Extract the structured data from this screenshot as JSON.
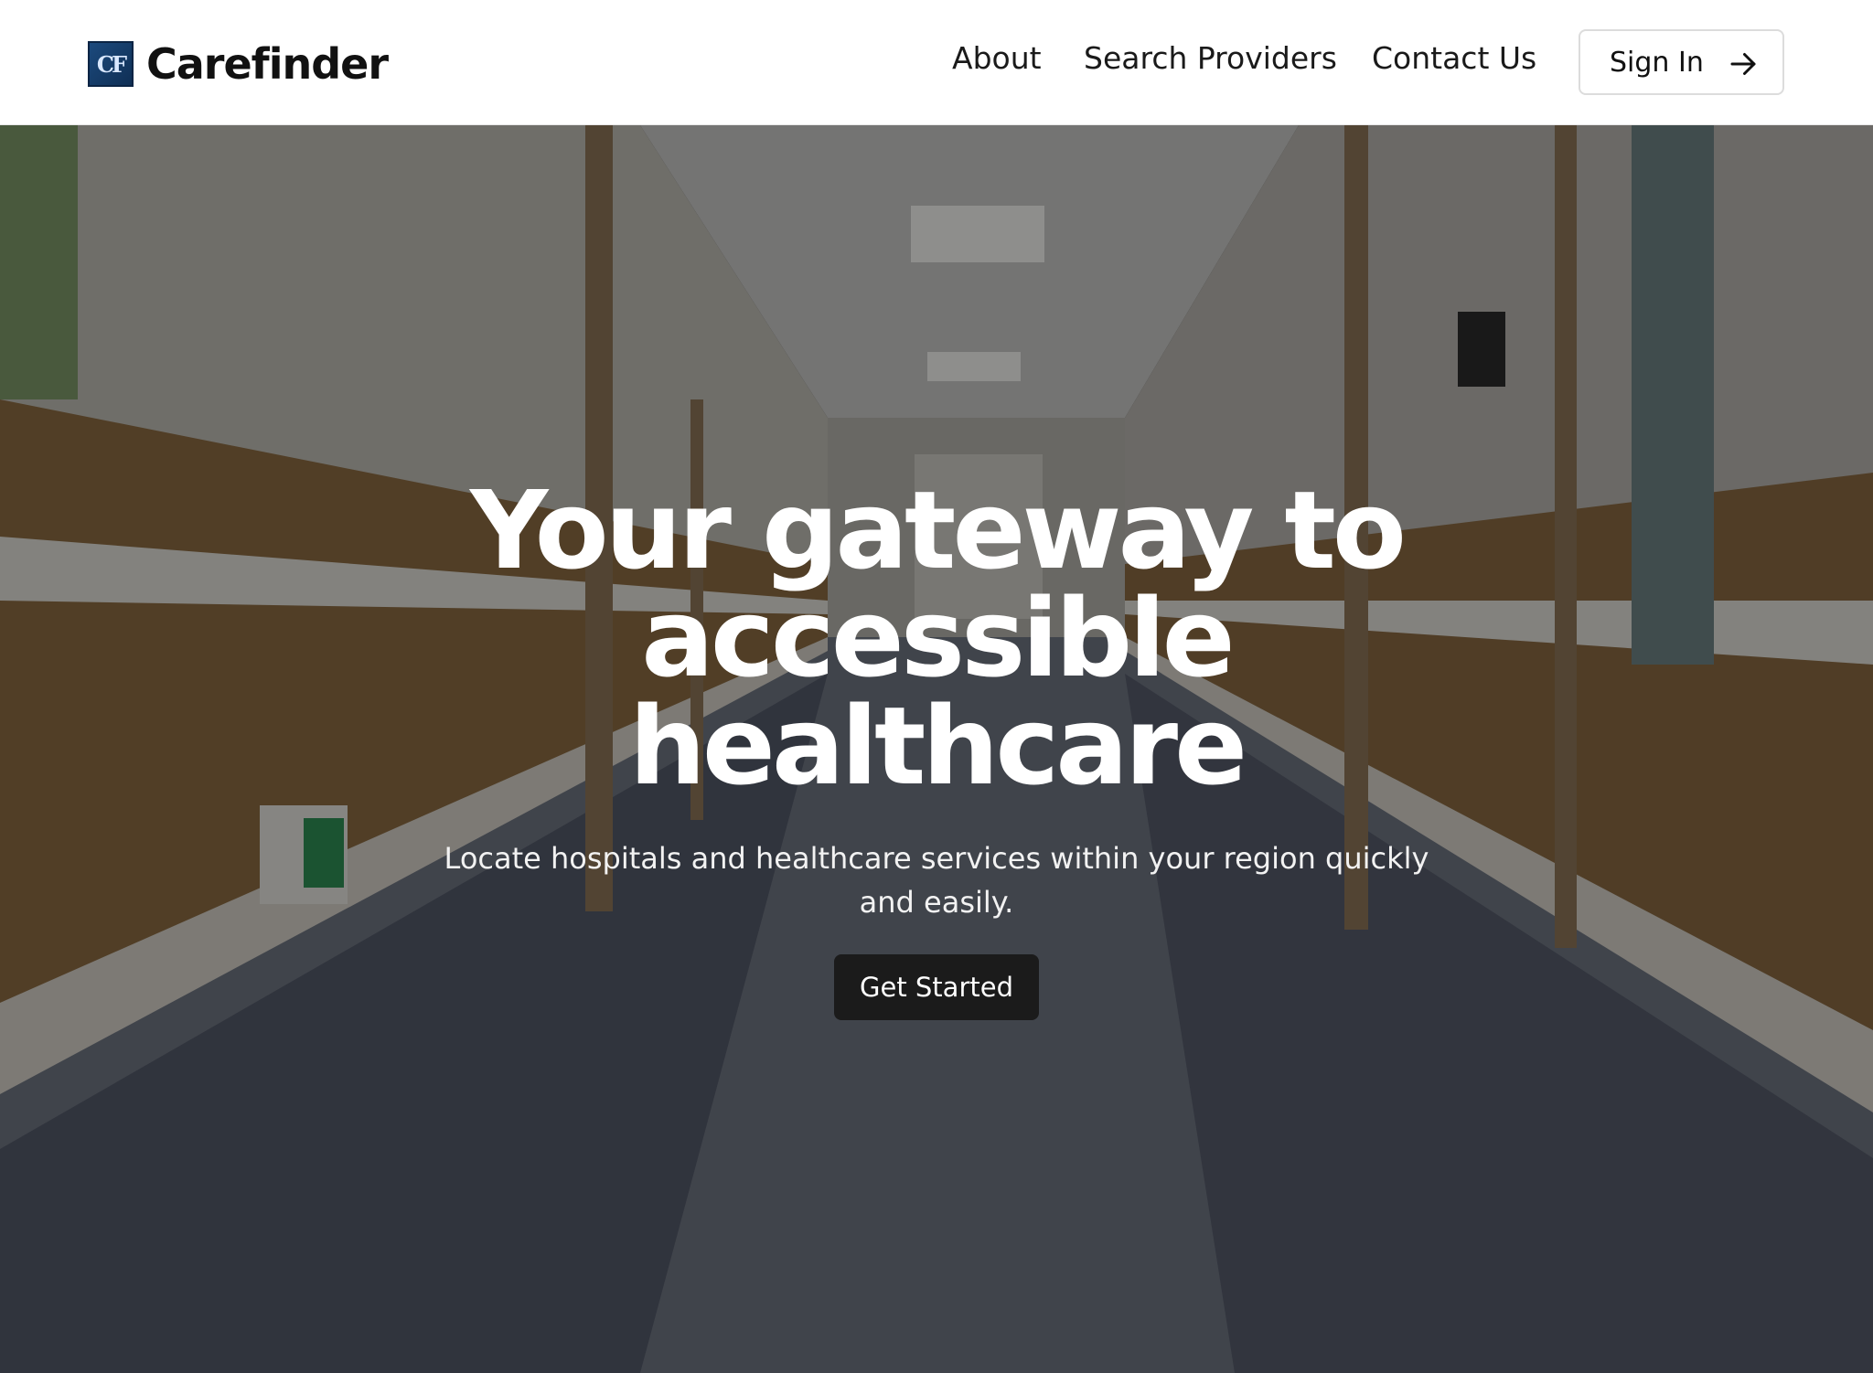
{
  "header": {
    "logo_text": "CF",
    "brand_name": "Carefinder",
    "nav": [
      "About",
      "Search Providers",
      "Contact Us"
    ],
    "signin_label": "Sign In"
  },
  "hero": {
    "headline_lines": [
      "Your gateway to",
      "accessible",
      "healthcare"
    ],
    "subtitle": "Locate hospitals and healthcare services within your region quickly and easily.",
    "cta_label": "Get Started"
  },
  "colors": {
    "header_bg": "#ffffff",
    "cta_bg": "#1b1b1b",
    "hero_text": "#ffffff"
  },
  "icons": {
    "logo": "carefinder-logo",
    "signin": "arrow-right-icon"
  }
}
